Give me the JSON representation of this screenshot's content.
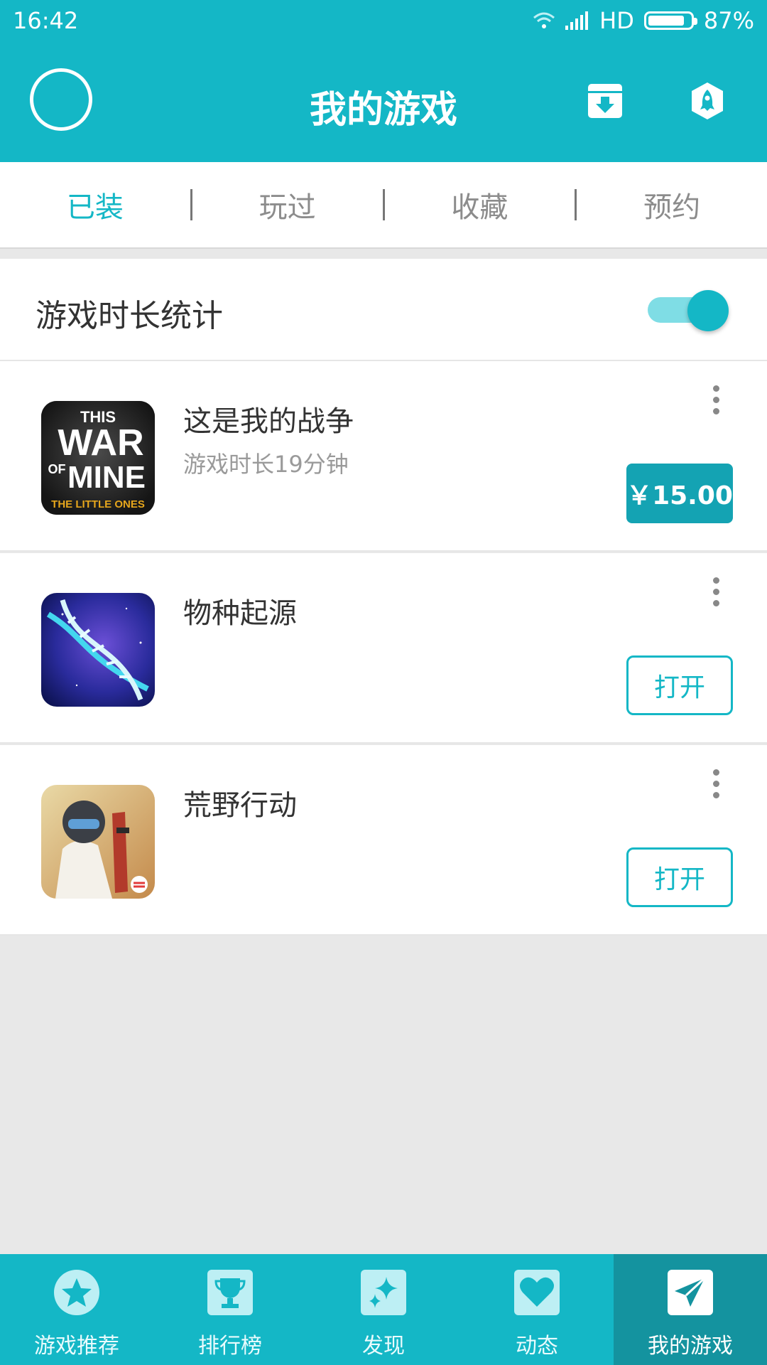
{
  "status": {
    "time": "16:42",
    "network": "HD",
    "battery": "87%",
    "battery_level": 0.87
  },
  "header": {
    "title": "我的游戏",
    "icons": [
      "avatar-circle",
      "download-box-icon",
      "rocket-icon"
    ]
  },
  "tabs": [
    {
      "label": "已装",
      "active": true
    },
    {
      "label": "玩过",
      "active": false
    },
    {
      "label": "收藏",
      "active": false
    },
    {
      "label": "预约",
      "active": false
    }
  ],
  "playtime_toggle": {
    "label": "游戏时长统计",
    "on": true
  },
  "games": [
    {
      "name": "这是我的战争",
      "subtitle": "游戏时长19分钟",
      "action": "￥15.00",
      "action_type": "price",
      "icon_text": [
        "THIS",
        "WAR",
        "OF",
        "MINE",
        "THE LITTLE ONES"
      ]
    },
    {
      "name": "物种起源",
      "subtitle": "",
      "action": "打开",
      "action_type": "open"
    },
    {
      "name": "荒野行动",
      "subtitle": "",
      "action": "打开",
      "action_type": "open"
    }
  ],
  "bottom_nav": [
    {
      "label": "游戏推荐",
      "icon": "star-icon",
      "active": false
    },
    {
      "label": "排行榜",
      "icon": "trophy-icon",
      "active": false
    },
    {
      "label": "发现",
      "icon": "sparkle-icon",
      "active": false
    },
    {
      "label": "动态",
      "icon": "heart-icon",
      "active": false
    },
    {
      "label": "我的游戏",
      "icon": "paper-plane-icon",
      "active": true
    }
  ],
  "colors": {
    "accent": "#14b7c6",
    "accent_dark": "#14939f",
    "price_button": "#14a3b3"
  }
}
